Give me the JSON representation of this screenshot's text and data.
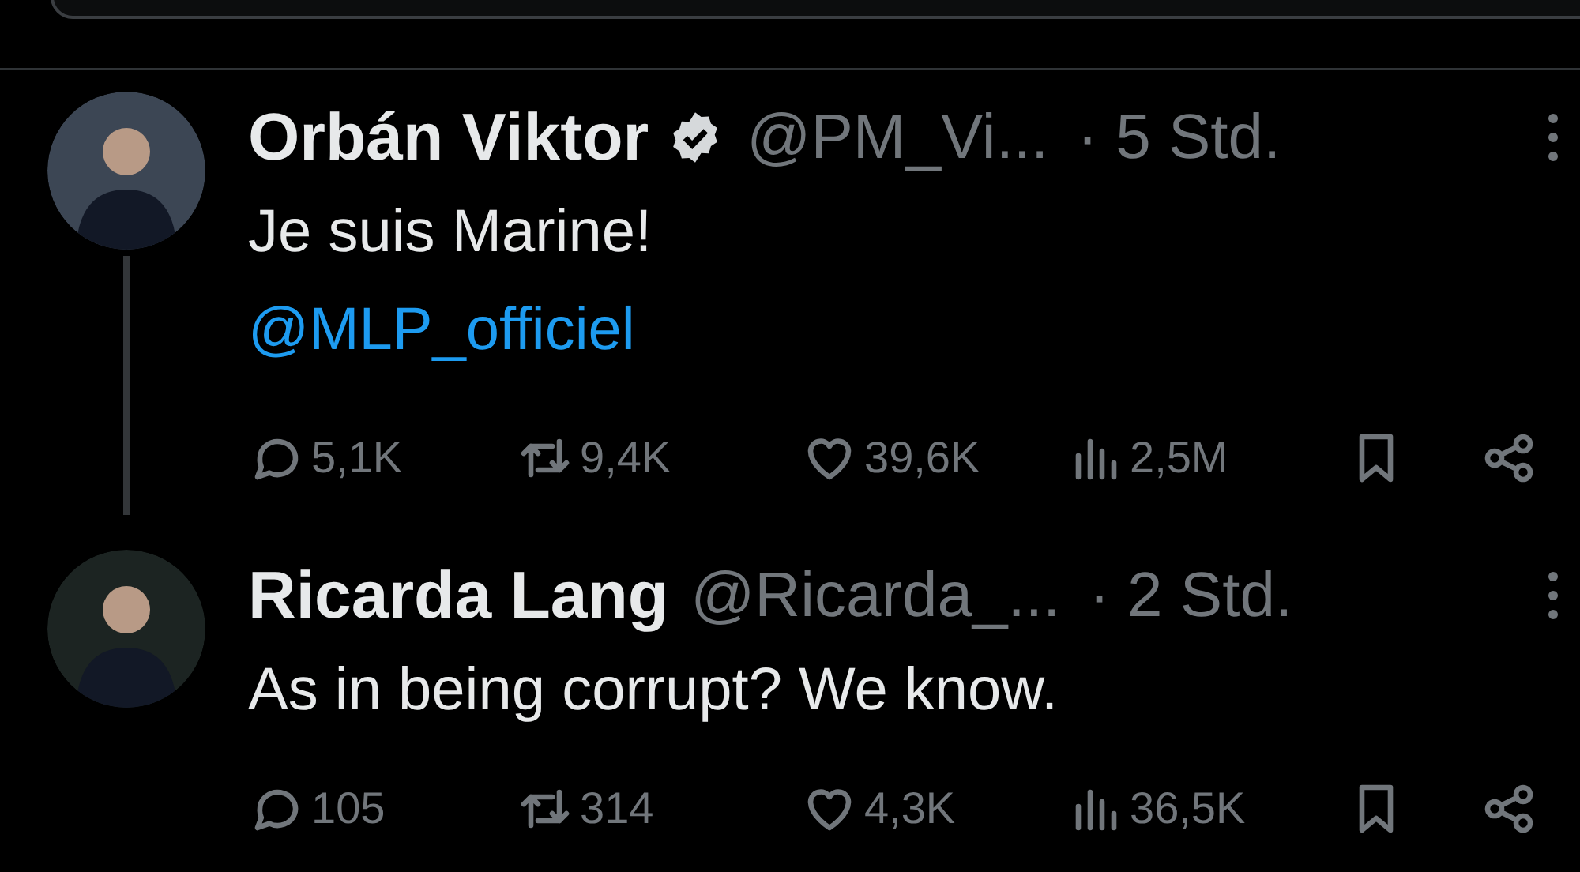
{
  "tweets": [
    {
      "name": "Orbán Viktor",
      "verified": true,
      "handle": "@PM_Vi...",
      "time": "· 5 Std.",
      "text": "Je suis Marine!",
      "mention": "@MLP_officiel",
      "thread_below": true,
      "stats": {
        "replies": "5,1K",
        "retweets": "9,4K",
        "likes": "39,6K",
        "views": "2,5M"
      }
    },
    {
      "name": "Ricarda Lang",
      "verified": false,
      "handle": "@Ricarda_...",
      "time": "· 2 Std.",
      "text": "As in being corrupt? We know.",
      "thread_below": false,
      "stats": {
        "replies": "105",
        "retweets": "314",
        "likes": "4,3K",
        "views": "36,5K"
      }
    }
  ]
}
